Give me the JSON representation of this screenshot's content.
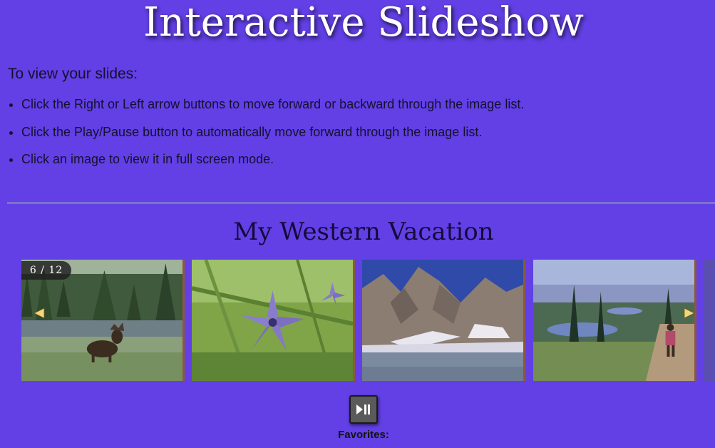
{
  "page": {
    "title": "Interactive Slideshow"
  },
  "instructions": {
    "heading": "To view your slides:",
    "items": [
      "Click the Right or Left arrow buttons to move forward or backward through the image list.",
      "Click the Play/Pause button to automatically move forward through the image list.",
      "Click an image to view it in full screen mode."
    ]
  },
  "gallery": {
    "title": "My Western Vacation",
    "counter": {
      "current": "6",
      "separator": " / ",
      "total": "12"
    },
    "slides": [
      {
        "subject": "moose in meadow by mountain lake"
      },
      {
        "subject": "purple wildflower close-up"
      },
      {
        "subject": "rocky mountain peak above lake"
      },
      {
        "subject": "hiker on trail overlooking lakes"
      },
      {
        "subject": "partial next slide"
      }
    ],
    "controls": {
      "prev_icon": "triangle-left-icon",
      "next_icon": "triangle-right-icon",
      "play_pause_icon": "play-pause-icon"
    },
    "favorites_label": "Favorites:"
  },
  "colors": {
    "background": "#6240e5",
    "title_text": "#ffffff",
    "arrow": "#f4d77a",
    "slide_border": "#8a5a3a"
  }
}
